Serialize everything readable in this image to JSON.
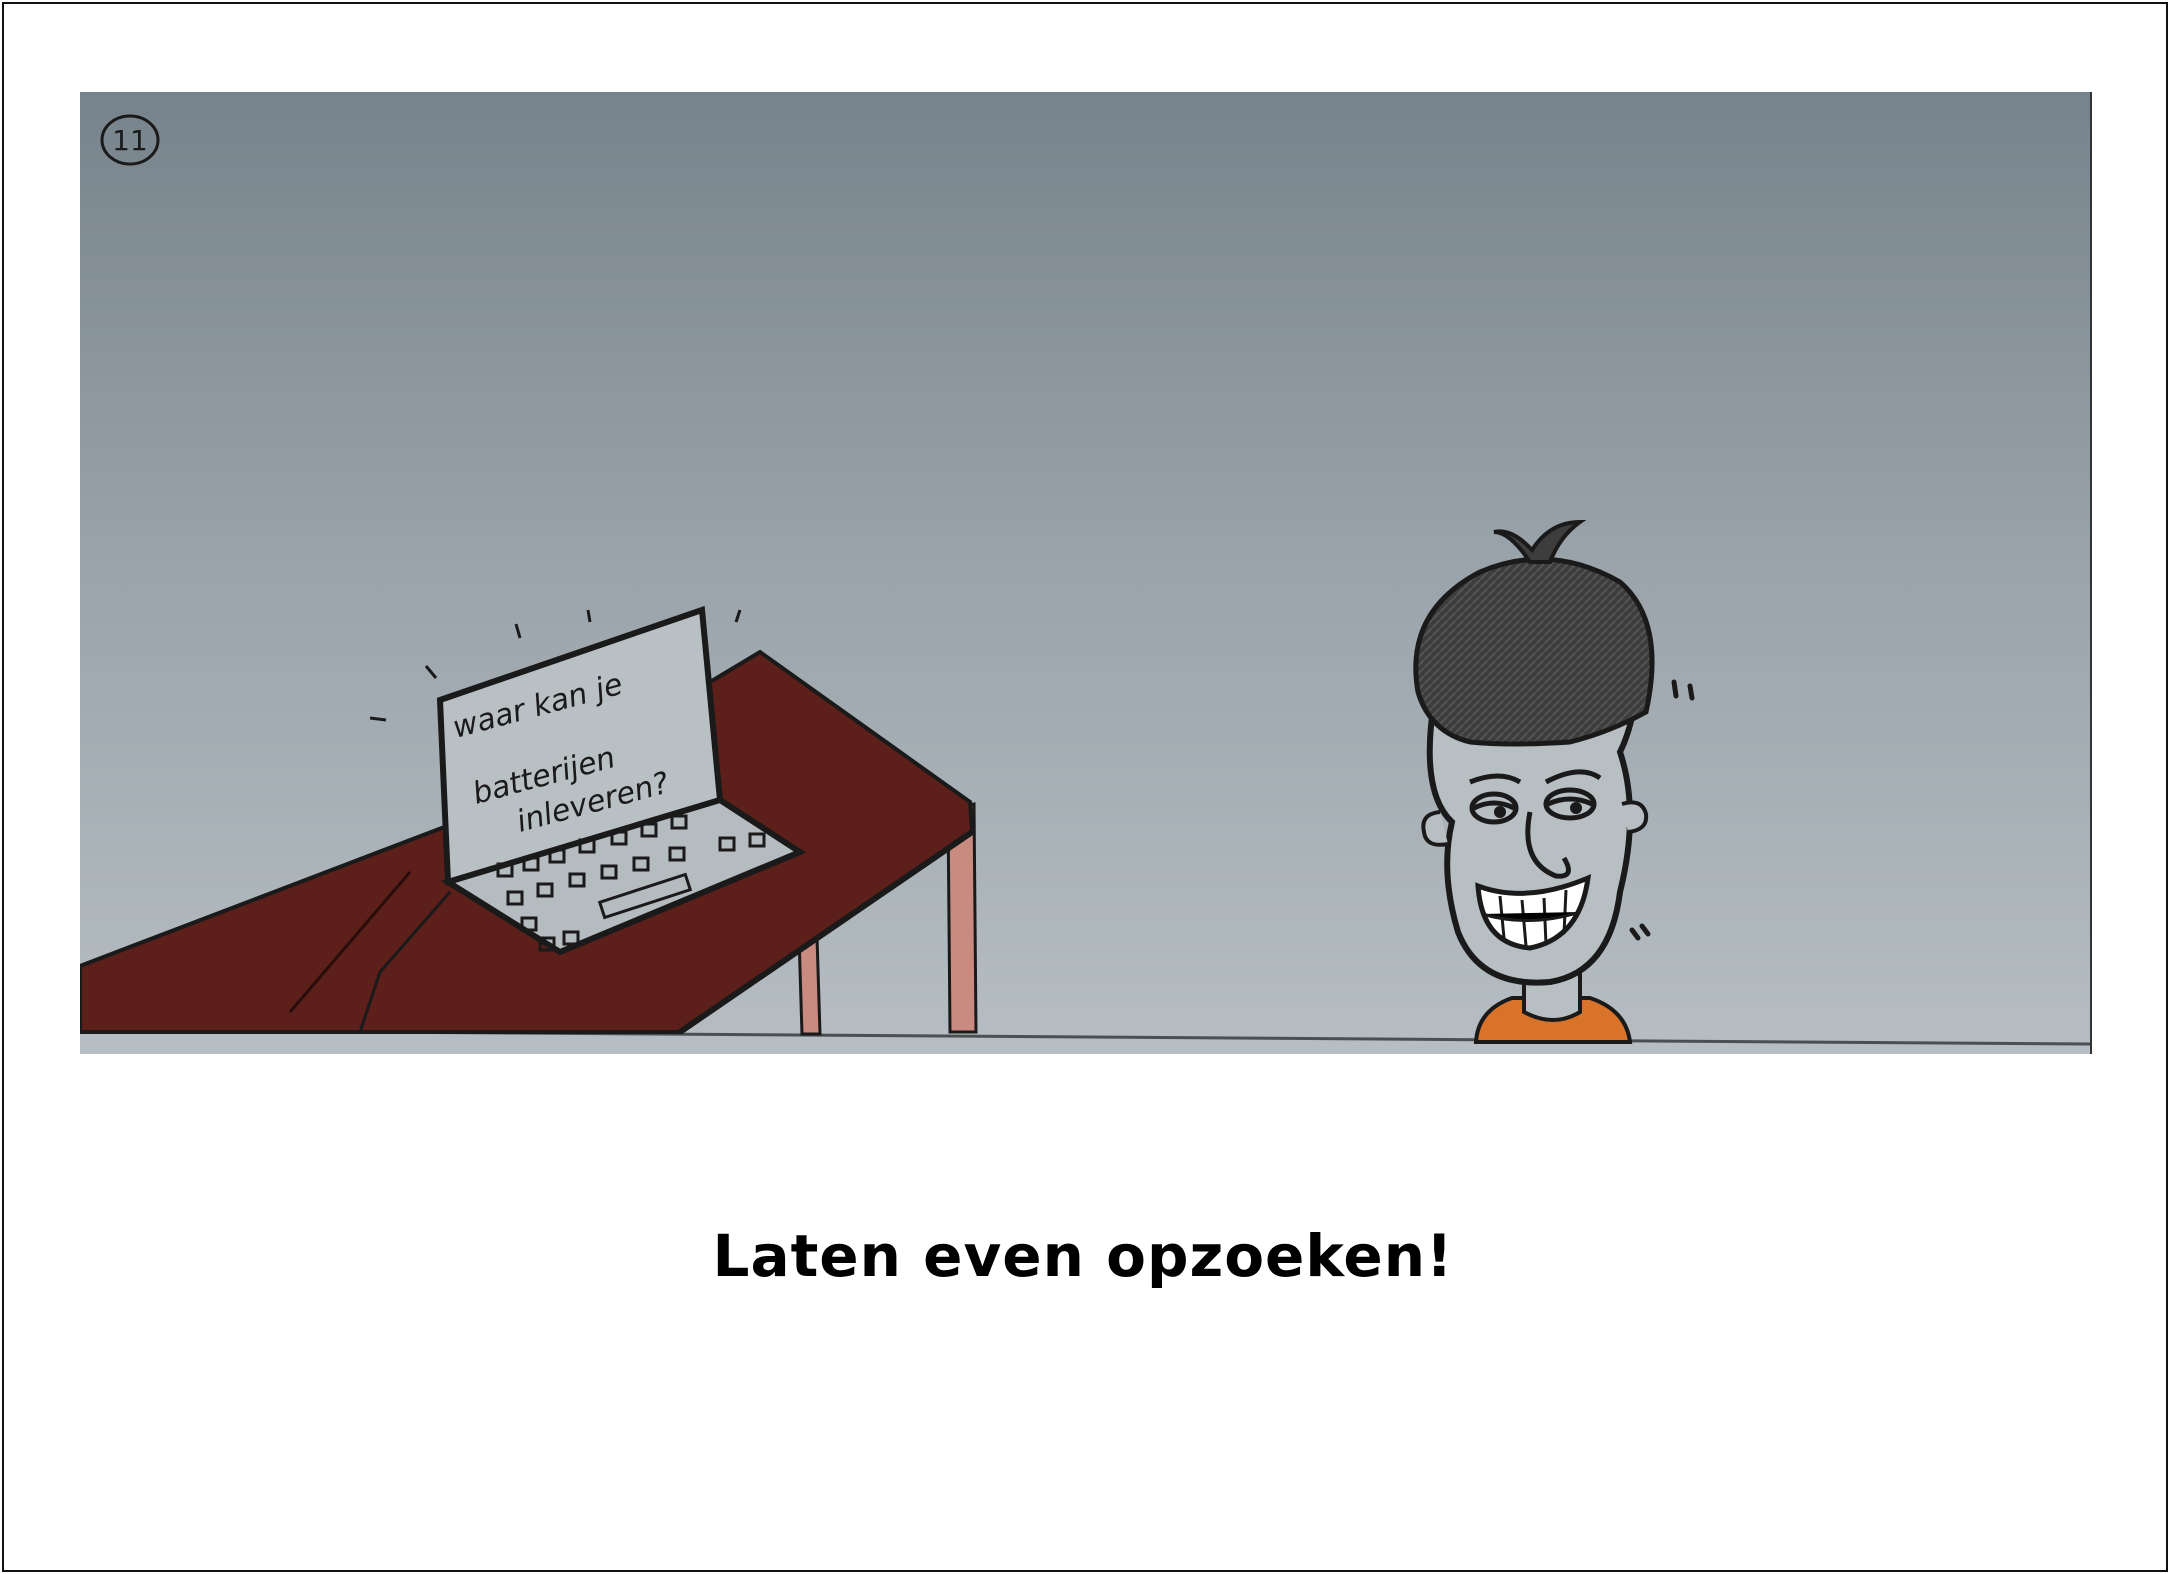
{
  "panel": {
    "number": "11",
    "screen_lines": [
      "waar kan je",
      "batterijen",
      "inleveren?"
    ]
  },
  "caption": "Laten even opzoeken!",
  "colors": {
    "wall_top": "#7b8790",
    "wall_bottom": "#b3bbc0",
    "table": "#5c1f1a",
    "table_leg": "#c98a80",
    "hair": "#3a3a3a",
    "shirt": "#d9732a",
    "ink": "#1a1a1a"
  }
}
